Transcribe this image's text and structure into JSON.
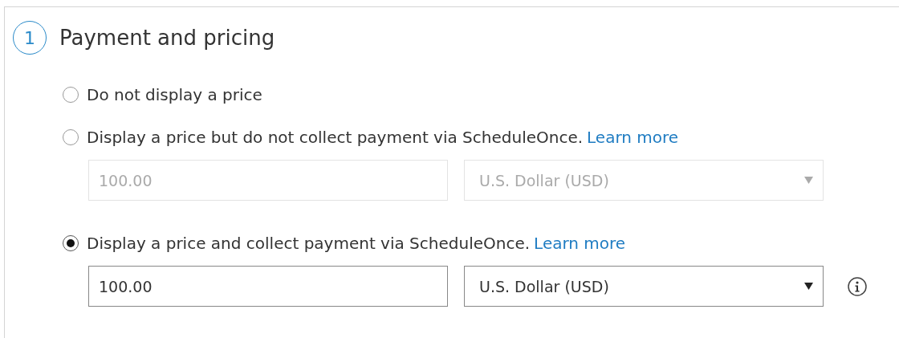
{
  "section": {
    "step": "1",
    "title": "Payment and pricing"
  },
  "options": [
    {
      "label": "Do not display a price",
      "selected": false
    },
    {
      "label": "Display a price but do not collect payment via ScheduleOnce.",
      "link": "Learn more",
      "selected": false,
      "fields": {
        "amount": "100.00",
        "currency": "U.S. Dollar (USD)",
        "disabled": true,
        "info_icon": false
      }
    },
    {
      "label": "Display a price and collect payment via ScheduleOnce.",
      "link": "Learn more",
      "selected": true,
      "fields": {
        "amount": "100.00",
        "currency": "U.S. Dollar (USD)",
        "disabled": false,
        "info_icon": true
      }
    }
  ]
}
